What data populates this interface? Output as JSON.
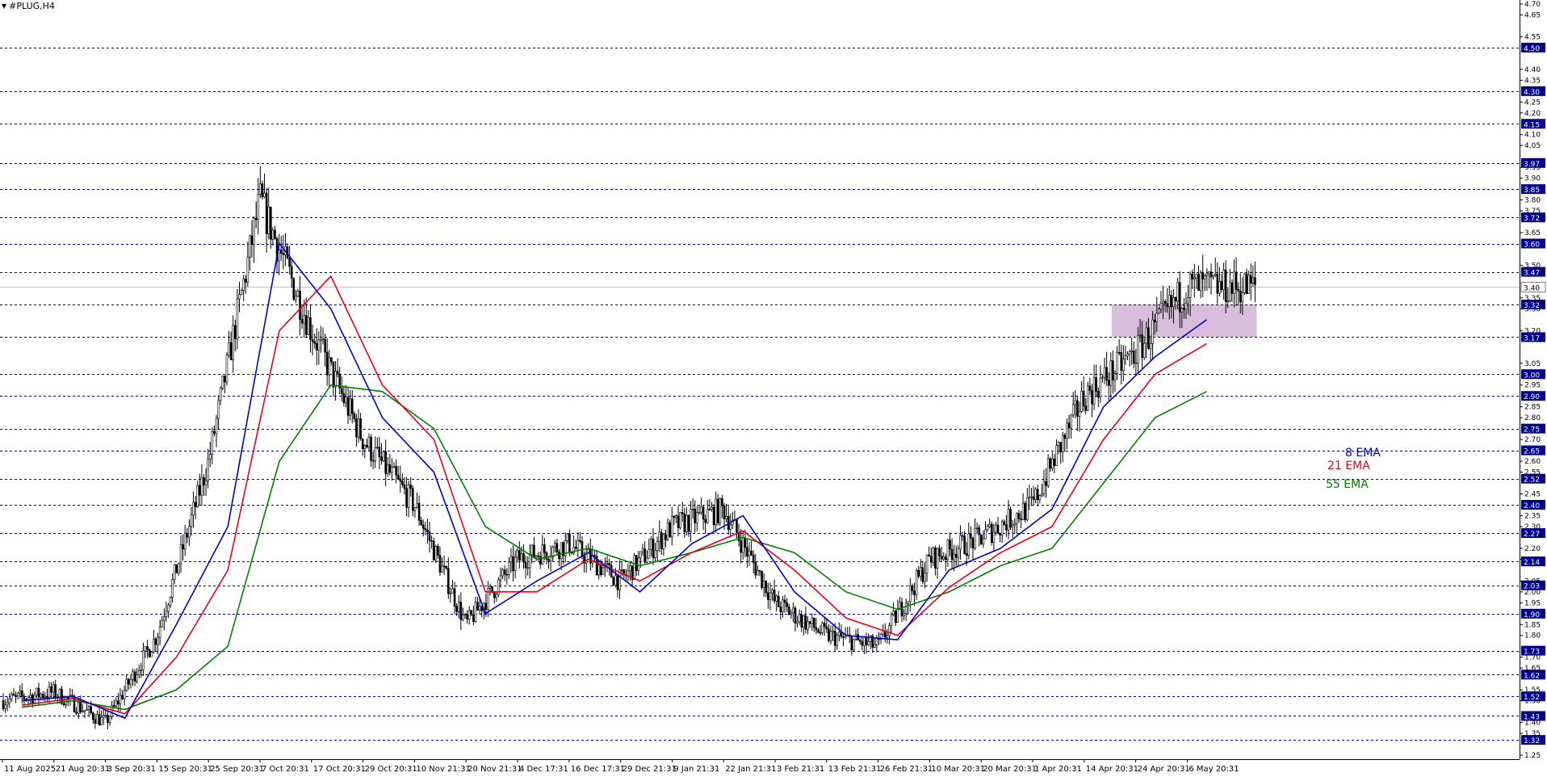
{
  "window": {
    "title": "#PLUG,H4"
  },
  "colors": {
    "background": "#ffffff",
    "candles": "#000000",
    "ema8": "#0000cc",
    "ema21": "#e8001c",
    "ema55": "#008000",
    "levels": "#00008b",
    "zone": "#d8bedc",
    "current_price_line": "#c0c0c0"
  },
  "legend": {
    "ema8": "8 EMA",
    "ema21": "21 EMA",
    "ema55": "55 EMA"
  },
  "chart_data": {
    "type": "candlestick",
    "symbol": "#PLUG",
    "timeframe": "H4",
    "ylim": [
      1.25,
      4.7
    ],
    "y_ticks": [
      "4.70",
      "4.65",
      "4.55",
      "4.40",
      "4.35",
      "4.25",
      "4.20",
      "4.10",
      "4.05",
      "3.95",
      "3.90",
      "3.80",
      "3.75",
      "3.65",
      "3.50",
      "3.35",
      "3.30",
      "3.20",
      "3.05",
      "2.95",
      "2.85",
      "2.80",
      "2.70",
      "2.60",
      "2.55",
      "2.45",
      "2.35",
      "2.30",
      "2.20",
      "2.15",
      "2.05",
      "2.00",
      "1.95",
      "1.85",
      "1.80",
      "1.70",
      "1.65",
      "1.55",
      "1.50",
      "1.40",
      "1.35",
      "1.25"
    ],
    "x_ticks": [
      "11 Aug 2025",
      "21 Aug 20:31",
      "3 Sep 20:31",
      "15 Sep 20:31",
      "25 Sep 20:31",
      "7 Oct 20:31",
      "17 Oct 20:31",
      "29 Oct 20:31",
      "10 Nov 21:31",
      "20 Nov 21:31",
      "4 Dec 17:31",
      "16 Dec 17:31",
      "29 Dec 21:31",
      "9 Jan 21:31",
      "22 Jan 21:31",
      "3 Feb 21:31",
      "13 Feb 21:31",
      "26 Feb 21:31",
      "10 Mar 20:31",
      "20 Mar 20:31",
      "1 Apr 20:31",
      "14 Apr 20:31",
      "24 Apr 20:31",
      "6 May 20:31"
    ],
    "levels": [
      4.5,
      4.3,
      4.15,
      3.97,
      3.85,
      3.72,
      3.6,
      3.47,
      3.32,
      3.17,
      3.0,
      2.9,
      2.75,
      2.65,
      2.52,
      2.4,
      2.27,
      2.14,
      2.03,
      1.9,
      1.73,
      1.62,
      1.52,
      1.43,
      1.32
    ],
    "level_labels": [
      "4.50",
      "4.30",
      "4.15",
      "3.97",
      "3.85",
      "3.72",
      "3.60",
      "3.47",
      "3.32",
      "3.17",
      "3.00",
      "2.90",
      "2.75",
      "2.65",
      "2.52",
      "2.40",
      "2.27",
      "2.14",
      "2.03",
      "1.90",
      "1.73",
      "1.62",
      "1.52",
      "1.43",
      "1.32"
    ],
    "current_price": 3.4,
    "current_price_label": "3.40",
    "zone": {
      "from_date": "14 Apr 20:31",
      "to_date": "6 May 20:31",
      "low": 3.17,
      "high": 3.32
    },
    "price_path": [
      {
        "x": "11 Aug 2025",
        "close": 1.5
      },
      {
        "x": "21 Aug 20:31",
        "close": 1.54
      },
      {
        "x": "3 Sep 20:31",
        "close": 1.4
      },
      {
        "x": "15 Sep 20:31",
        "close": 1.8
      },
      {
        "x": "25 Sep 20:31",
        "close": 2.6
      },
      {
        "x": "7 Oct 20:31",
        "close": 3.8
      },
      {
        "x": "17 Oct 20:31",
        "close": 3.2
      },
      {
        "x": "29 Oct 20:31",
        "close": 2.7
      },
      {
        "x": "10 Nov 21:31",
        "close": 2.4
      },
      {
        "x": "20 Nov 21:31",
        "close": 1.85
      },
      {
        "x": "4 Dec 17:31",
        "close": 2.15
      },
      {
        "x": "16 Dec 17:31",
        "close": 2.22
      },
      {
        "x": "29 Dec 21:31",
        "close": 2.05
      },
      {
        "x": "9 Jan 21:31",
        "close": 2.3
      },
      {
        "x": "22 Jan 21:31",
        "close": 2.38
      },
      {
        "x": "3 Feb 21:31",
        "close": 1.95
      },
      {
        "x": "13 Feb 21:31",
        "close": 1.8
      },
      {
        "x": "26 Feb 21:31",
        "close": 1.75
      },
      {
        "x": "10 Mar 20:31",
        "close": 2.15
      },
      {
        "x": "20 Mar 20:31",
        "close": 2.25
      },
      {
        "x": "1 Apr 20:31",
        "close": 2.4
      },
      {
        "x": "14 Apr 20:31",
        "close": 2.9
      },
      {
        "x": "24 Apr 20:31",
        "close": 3.1
      },
      {
        "x": "6 May 20:31",
        "close": 3.4
      }
    ],
    "ema8_path": [
      1.5,
      1.52,
      1.42,
      1.85,
      2.3,
      3.6,
      3.3,
      2.8,
      2.55,
      1.9,
      2.05,
      2.18,
      2.0,
      2.22,
      2.35,
      2.0,
      1.8,
      1.78,
      2.1,
      2.2,
      2.38,
      2.85,
      3.08,
      3.25
    ],
    "ema21_path": [
      1.48,
      1.51,
      1.44,
      1.7,
      2.1,
      3.2,
      3.45,
      2.95,
      2.7,
      2.0,
      2.0,
      2.15,
      2.05,
      2.18,
      2.28,
      2.1,
      1.88,
      1.8,
      2.02,
      2.18,
      2.3,
      2.7,
      3.0,
      3.14
    ],
    "ema55_path": [
      1.47,
      1.5,
      1.46,
      1.55,
      1.75,
      2.6,
      2.95,
      2.92,
      2.75,
      2.3,
      2.15,
      2.2,
      2.12,
      2.18,
      2.25,
      2.18,
      2.0,
      1.92,
      2.0,
      2.12,
      2.2,
      2.5,
      2.8,
      2.92
    ],
    "grid": false,
    "legend_position": "right"
  }
}
